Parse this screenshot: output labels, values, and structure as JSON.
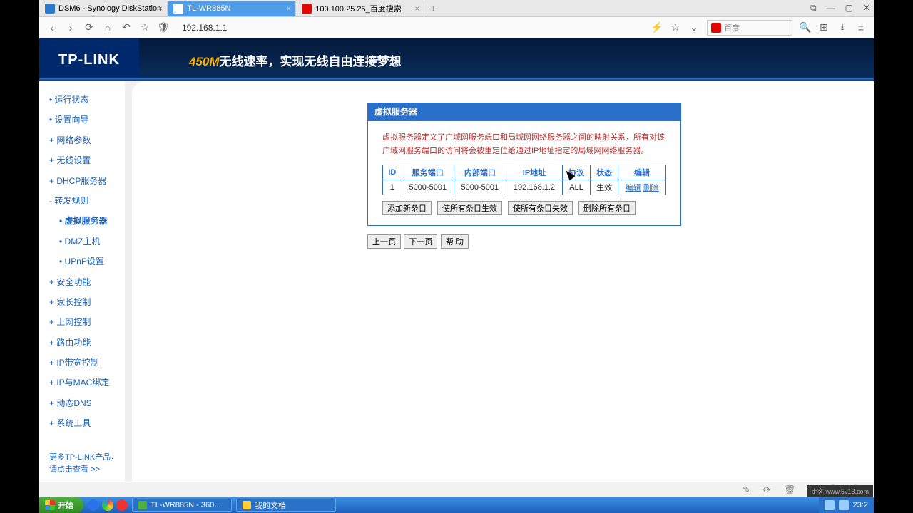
{
  "tabs": [
    {
      "title": "DSM6 - Synology DiskStation"
    },
    {
      "title": "TL-WR885N"
    },
    {
      "title": "100.100.25.25_百度搜索"
    }
  ],
  "url": "192.168.1.1",
  "search_placeholder": "百度",
  "logo": "TP-LINK",
  "slogan_hl": "450M",
  "slogan_rest": "无线速率，实现无线自由连接梦想",
  "menu": {
    "items": [
      "运行状态",
      "设置向导",
      "网络参数",
      "无线设置",
      "DHCP服务器"
    ],
    "forward": "转发规则",
    "sub": [
      "虚拟服务器",
      "DMZ主机",
      "UPnP设置"
    ],
    "rest": [
      "安全功能",
      "家长控制",
      "上网控制",
      "路由功能",
      "IP带宽控制",
      "IP与MAC绑定",
      "动态DNS",
      "系统工具"
    ],
    "more1": "更多TP-LINK产品，",
    "more2": "请点击查看 >>"
  },
  "panel": {
    "title": "虚拟服务器",
    "desc": "虚拟服务器定义了广域网服务端口和局域网网络服务器之间的映射关系，所有对该广域网服务端口的访问将会被重定位给通过IP地址指定的局域网网络服务器。",
    "headers": [
      "ID",
      "服务端口",
      "内部端口",
      "IP地址",
      "协议",
      "状态",
      "编辑"
    ],
    "row": {
      "id": "1",
      "svc": "5000-5001",
      "int": "5000-5001",
      "ip": "192.168.1.2",
      "proto": "ALL",
      "status": "生效",
      "edit": "编辑",
      "del": "删除"
    },
    "btns": [
      "添加新条目",
      "使所有条目生效",
      "使所有条目失效",
      "删除所有条目"
    ],
    "pager": [
      "上一页",
      "下一页",
      "帮 助"
    ]
  },
  "taskbar": {
    "start": "开始",
    "tasks": [
      "TL-WR885N - 360...",
      "我的文档"
    ],
    "clock": "23:2"
  },
  "watermark": "走客 www.5v13.com"
}
